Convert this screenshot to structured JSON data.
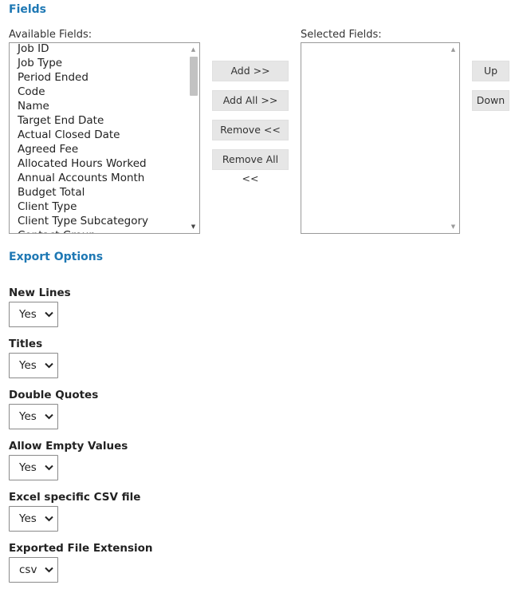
{
  "fields_section": {
    "title": "Fields",
    "available_label": "Available Fields:",
    "selected_label": "Selected Fields:",
    "available_items": [
      "Job ID",
      "Job Type",
      "Period Ended",
      "Code",
      "Name",
      "Target End Date",
      "Actual Closed Date",
      "Agreed Fee",
      "Allocated Hours Worked",
      "Annual Accounts Month",
      "Budget Total",
      "Client Type",
      "Client Type Subcategory",
      "Contact Group"
    ],
    "selected_items": [],
    "buttons": {
      "add": "Add >>",
      "add_all": "Add All >>",
      "remove": "Remove <<",
      "remove_all": "Remove All <<",
      "up": "Up",
      "down": "Down"
    }
  },
  "export_section": {
    "title": "Export Options",
    "options": [
      {
        "label": "New Lines",
        "value": "Yes"
      },
      {
        "label": "Titles",
        "value": "Yes"
      },
      {
        "label": "Double Quotes",
        "value": "Yes"
      },
      {
        "label": "Allow Empty Values",
        "value": "Yes"
      },
      {
        "label": "Excel specific CSV file",
        "value": "Yes"
      },
      {
        "label": "Exported File Extension",
        "value": "csv"
      }
    ]
  },
  "colors": {
    "accent": "#1e78b4",
    "button_bg": "#e6e6e6"
  }
}
